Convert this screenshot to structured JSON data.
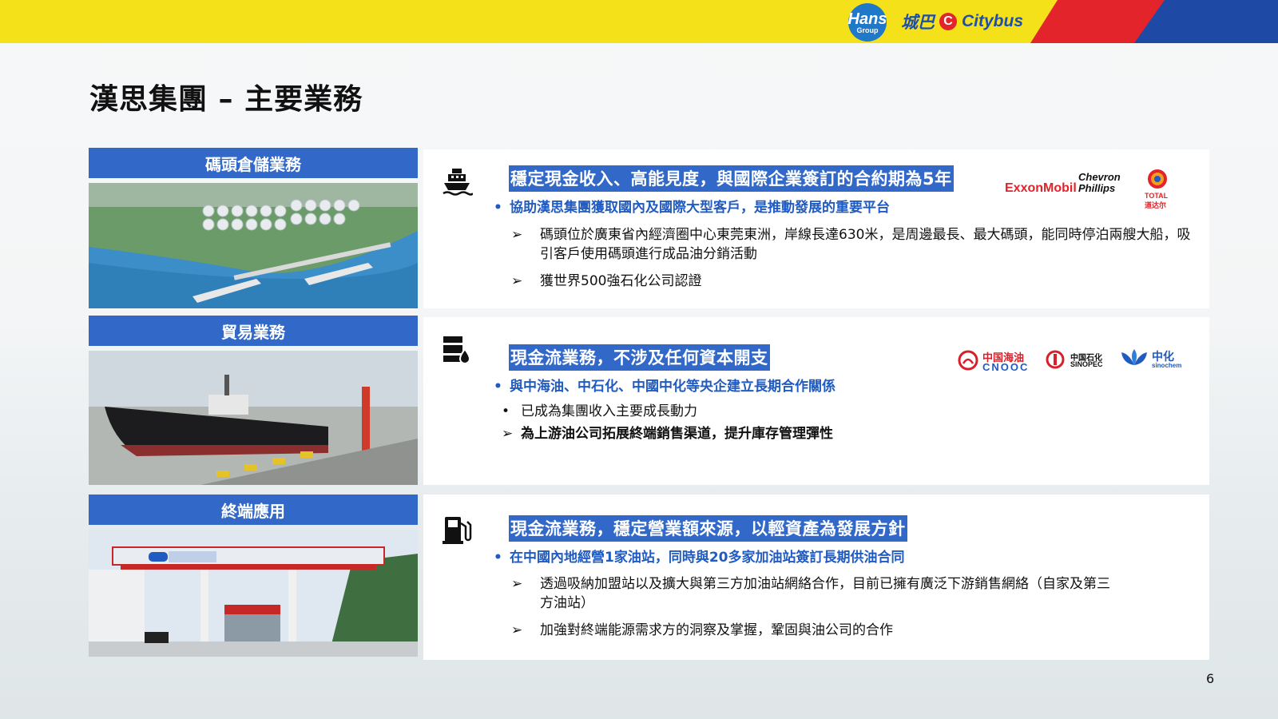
{
  "header": {
    "hans_logo_line1": "Hans",
    "hans_logo_line2": "Group",
    "citybus_chinese": "城巴",
    "citybus_english": "Citybus"
  },
  "page": {
    "title": "漢思集團 – 主要業務",
    "page_number": "6"
  },
  "sections": [
    {
      "header": "碼頭倉儲業務",
      "icon": "ship-icon",
      "highlight_title": "穩定現金收入、高能見度，與國際企業簽訂的合約期為5年",
      "subtitle": "協助漢思集團獲取國內及國際大型客戶，是推動發展的重要平台",
      "items": [
        "碼頭位於廣東省內經濟圈中心東莞東洲，岸線長達630米，是周邊最長、最大碼頭，能同時停泊兩艘大船，吸引客戶使用碼頭進行成品油分銷活動",
        "獲世界500強石化公司認證"
      ],
      "logos": [
        "ExxonMobil",
        "Chevron Phillips",
        "TOTAL",
        "道达尔"
      ]
    },
    {
      "header": "貿易業務",
      "icon": "oil-barrel-icon",
      "highlight_title": "現金流業務，不涉及任何資本開支",
      "subtitle": "與中海油、中石化、中國中化等央企建立長期合作關係",
      "items": [
        "已成為集團收入主要成長動力",
        "為上游油公司拓展終端銷售渠道，提升庫存管理彈性"
      ],
      "logos": [
        "中国海油",
        "CNOOC",
        "中国石化",
        "SINOPEC",
        "中化",
        "sinochem"
      ]
    },
    {
      "header": "終端應用",
      "icon": "fuel-pump-icon",
      "highlight_title": "現金流業務，穩定營業額來源，以輕資產為發展方針",
      "subtitle": "在中國內地經營1家油站，同時與20多家加油站簽訂長期供油合同",
      "items": [
        "透過吸納加盟站以及擴大與第三方加油站網絡合作，目前已擁有廣泛下游銷售網絡（自家及第三方油站）",
        "加強對終端能源需求方的洞察及掌握，鞏固與油公司的合作"
      ]
    }
  ],
  "colors": {
    "banner_yellow": "#f5e11a",
    "banner_red": "#e3242b",
    "banner_blue": "#1e4aa6",
    "section_blue": "#3269c8",
    "subtitle_blue": "#1f5bc1"
  }
}
